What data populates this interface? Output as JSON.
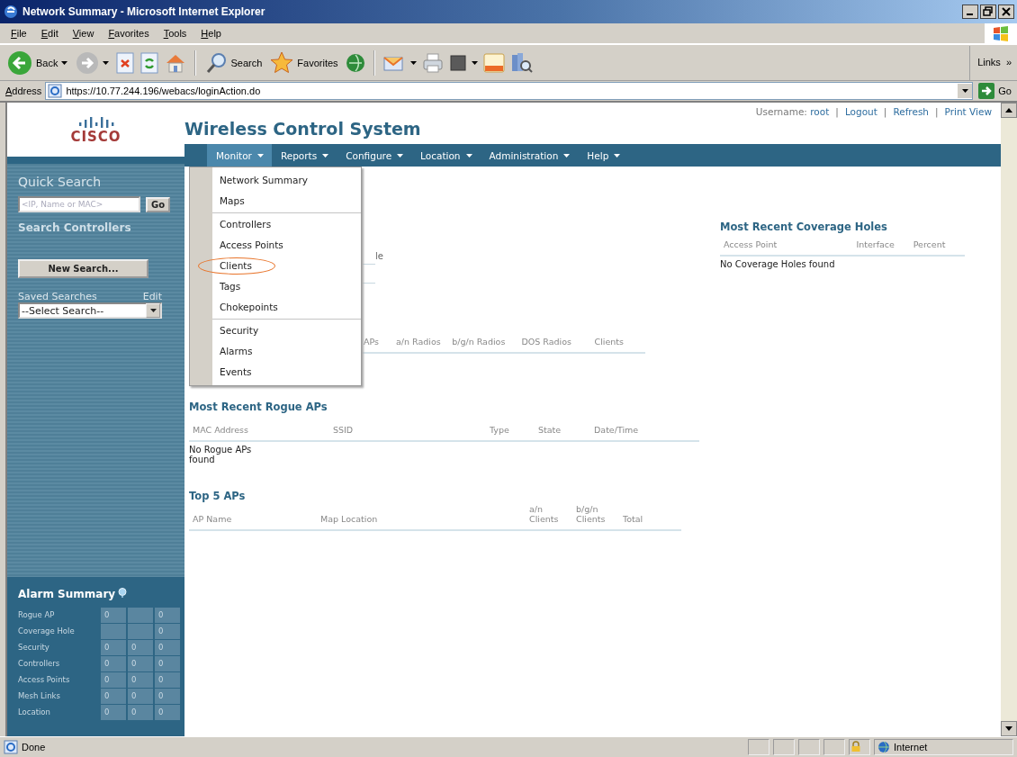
{
  "window": {
    "title": "Network Summary - Microsoft Internet Explorer"
  },
  "menu_bar": [
    "File",
    "Edit",
    "View",
    "Favorites",
    "Tools",
    "Help"
  ],
  "toolbar": {
    "back": "Back",
    "search": "Search",
    "favorites": "Favorites",
    "links": "Links",
    "links_more": "»"
  },
  "address_bar": {
    "label": "Address",
    "value": "https://10.77.244.196/webacs/loginAction.do",
    "go": "Go"
  },
  "app": {
    "logo": "CISCO",
    "title": "Wireless Control System",
    "user_bar": {
      "label": "Username:",
      "user": "root",
      "separator": "|",
      "links": [
        "Logout",
        "Refresh",
        "Print View"
      ]
    },
    "nav": [
      {
        "label": "Monitor",
        "selected": true
      },
      {
        "label": "Reports",
        "selected": false
      },
      {
        "label": "Configure",
        "selected": false
      },
      {
        "label": "Location",
        "selected": false
      },
      {
        "label": "Administration",
        "selected": false
      },
      {
        "label": "Help",
        "selected": false
      }
    ],
    "dropdown": {
      "groups": [
        {
          "items": [
            {
              "label": "Network Summary",
              "circled": false
            },
            {
              "label": "Maps",
              "circled": false
            }
          ]
        },
        {
          "items": [
            {
              "label": "Controllers",
              "circled": false
            },
            {
              "label": "Access Points",
              "circled": false
            },
            {
              "label": "Clients",
              "circled": true
            },
            {
              "label": "Tags",
              "circled": false
            },
            {
              "label": "Chokepoints",
              "circled": false
            }
          ]
        },
        {
          "items": [
            {
              "label": "Security",
              "circled": false
            },
            {
              "label": "Alarms",
              "circled": false
            },
            {
              "label": "Events",
              "circled": false
            }
          ]
        }
      ]
    },
    "sidebar": {
      "quick_search": {
        "title": "Quick Search",
        "placeholder": "<IP, Name or MAC>",
        "button": "Go"
      },
      "search_controllers": "Search Controllers",
      "new_search": "New Search...",
      "saved_searches": {
        "label": "Saved Searches",
        "edit": "Edit",
        "select": "--Select Search--"
      },
      "alarm_summary": {
        "title": "Alarm Summary",
        "rows": [
          {
            "name": "Rogue AP",
            "cells": [
              {
                "kind": "count",
                "text": "0"
              },
              {
                "kind": "blank"
              },
              {
                "kind": "count",
                "text": "0"
              }
            ]
          },
          {
            "name": "Coverage Hole",
            "cells": [
              {
                "kind": "blank"
              },
              {
                "kind": "blank"
              },
              {
                "kind": "count",
                "text": "0"
              }
            ]
          },
          {
            "name": "Security",
            "cells": [
              {
                "kind": "count",
                "text": "0"
              },
              {
                "kind": "count",
                "text": "0"
              },
              {
                "kind": "count",
                "text": "0"
              }
            ]
          },
          {
            "name": "Controllers",
            "cells": [
              {
                "kind": "count",
                "text": "0"
              },
              {
                "kind": "count",
                "text": "0"
              },
              {
                "kind": "count",
                "text": "0"
              }
            ]
          },
          {
            "name": "Access Points",
            "cells": [
              {
                "kind": "count",
                "text": "0"
              },
              {
                "kind": "count",
                "text": "0"
              },
              {
                "kind": "count",
                "text": "0"
              }
            ]
          },
          {
            "name": "Mesh Links",
            "cells": [
              {
                "kind": "count",
                "text": "0"
              },
              {
                "kind": "count",
                "text": "0"
              },
              {
                "kind": "count",
                "text": "0"
              }
            ]
          },
          {
            "name": "Location",
            "cells": [
              {
                "kind": "count",
                "text": "0"
              },
              {
                "kind": "count",
                "text": "0"
              },
              {
                "kind": "count",
                "text": "0"
              }
            ]
          }
        ]
      }
    },
    "main": {
      "overview_fragment": "le",
      "radio_columns": [
        "APs",
        "a/n Radios",
        "b/g/n Radios",
        "DOS Radios",
        "Clients"
      ],
      "rogue": {
        "title": "Most Recent Rogue APs",
        "columns": [
          "MAC Address",
          "SSID",
          "Type",
          "State",
          "Date/Time"
        ],
        "empty": "No Rogue APs found"
      },
      "top_aps": {
        "title": "Top 5 APs",
        "columns": [
          "AP Name",
          "Map Location",
          "a/n Clients",
          "b/g/n Clients",
          "Total"
        ]
      },
      "coverage": {
        "title": "Most Recent Coverage Holes",
        "columns": [
          "Access Point",
          "Interface",
          "Percent"
        ],
        "empty": "No Coverage Holes found"
      }
    }
  },
  "status_bar": {
    "text": "Done",
    "zone": "Internet"
  }
}
